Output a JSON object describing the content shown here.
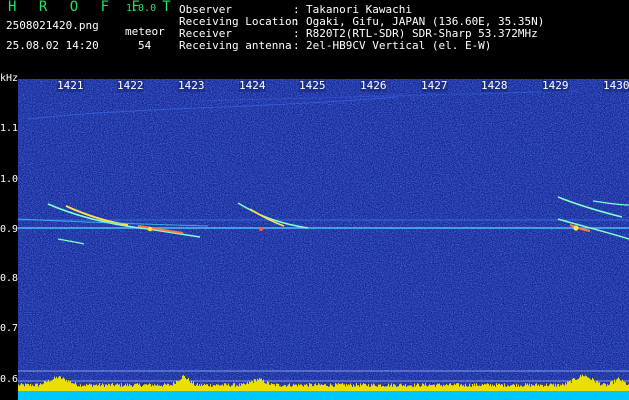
{
  "app": {
    "logo": "H R O F F T",
    "version": "1.0.0",
    "filename": "2508021420.png",
    "meteor_label": "meteor",
    "datetime": "25.08.02 14:20",
    "meteor_count": "54"
  },
  "header": {
    "rows": [
      {
        "label": "Observer",
        "value": "Takanori Kawachi"
      },
      {
        "label": "Receiving Location",
        "value": "Ogaki, Gifu, JAPAN (136.60E, 35.35N)"
      },
      {
        "label": "Receiver",
        "value": "R820T2(RTL-SDR) SDR-Sharp 53.372MHz"
      },
      {
        "label": "Receiving antenna",
        "value": "2el-HB9CV Vertical (el. E-W)"
      }
    ],
    "colon": ":"
  },
  "axes": {
    "y_unit": "kHz",
    "y_ticks": [
      "1.1",
      "1.0",
      "0.9",
      "0.8",
      "0.7",
      "0.6"
    ],
    "x_ticks": [
      "1421",
      "1422",
      "1423",
      "1424",
      "1425",
      "1426",
      "1427",
      "1428",
      "1429",
      "1430"
    ]
  },
  "colors": {
    "background": "#000000",
    "plot_noise": "#1a2f9e",
    "header_label": "#21e36a",
    "text": "#ffffff",
    "carrier": "#4fd6ff",
    "meteor": "#ffe24a",
    "spectrum_bar": "#e8e000",
    "baseline": "#00c8ff"
  }
}
